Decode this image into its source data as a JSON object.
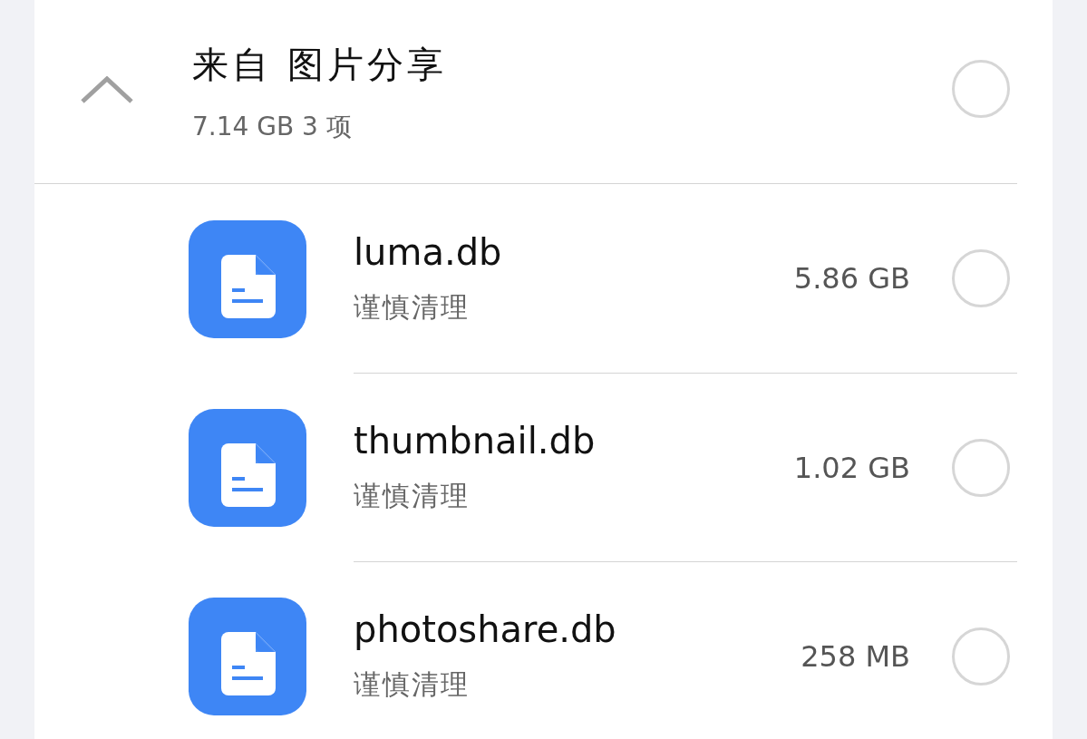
{
  "group": {
    "title": "来自 图片分享",
    "summary": "7.14 GB 3 项",
    "expanded": true,
    "selected": false
  },
  "files": [
    {
      "name": "luma.db",
      "status": "谨慎清理",
      "size": "5.86 GB",
      "selected": false
    },
    {
      "name": "thumbnail.db",
      "status": "谨慎清理",
      "size": "1.02 GB",
      "selected": false
    },
    {
      "name": "photoshare.db",
      "status": "谨慎清理",
      "size": "258 MB",
      "selected": false
    }
  ]
}
